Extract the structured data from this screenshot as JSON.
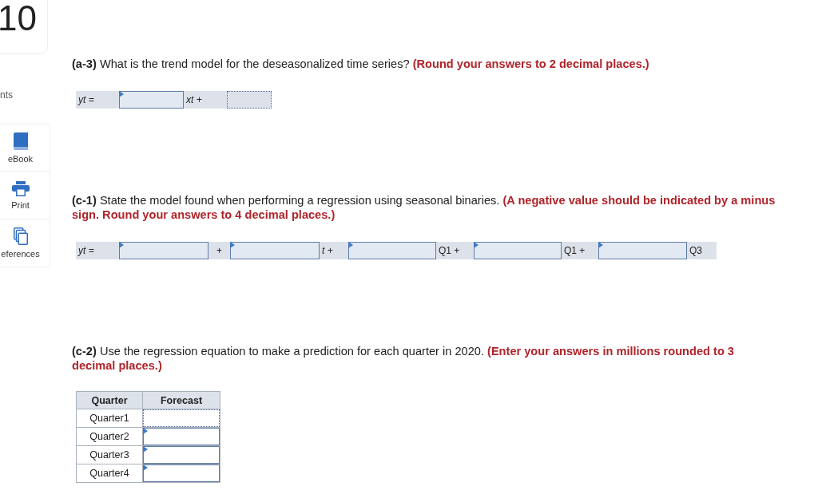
{
  "question_number": "10",
  "sidebar": {
    "points_label": "nts",
    "tools": [
      {
        "kind": "ebook",
        "label": "eBook"
      },
      {
        "kind": "print",
        "label": "Print"
      },
      {
        "kind": "references",
        "label": "eferences"
      }
    ]
  },
  "parts": [
    {
      "label": "(a-3)",
      "text": "What is the trend model for the deseasonalized time series?",
      "instruction": "(Round your answers to 2 decimal places.)",
      "equation": [
        {
          "kind": "variable",
          "text": "yt ="
        },
        {
          "kind": "field",
          "flagged": true,
          "focused": false
        },
        {
          "kind": "variable",
          "text": "xt +"
        },
        {
          "kind": "field",
          "flagged": false,
          "focused": true
        }
      ]
    },
    {
      "label": "(c-1)",
      "text": "State the model found when performing a regression using seasonal binaries.",
      "instruction": "(A negative value should be indicated by a minus sign. Round your answers to 4 decimal places.)",
      "equation": [
        {
          "kind": "variable",
          "text": "yt ="
        },
        {
          "kind": "field",
          "flagged": true,
          "focused": false
        },
        {
          "kind": "operator",
          "text": "+"
        },
        {
          "kind": "field",
          "flagged": true,
          "focused": false
        },
        {
          "kind": "variable",
          "text": "t +"
        },
        {
          "kind": "field",
          "flagged": true,
          "focused": false
        },
        {
          "kind": "label",
          "text": "Q1 +"
        },
        {
          "kind": "field",
          "flagged": true,
          "focused": false
        },
        {
          "kind": "label",
          "text": "Q1 +"
        },
        {
          "kind": "field",
          "flagged": true,
          "focused": false
        },
        {
          "kind": "label",
          "text": "Q3"
        }
      ]
    },
    {
      "label": "(c-2)",
      "text": "Use the regression equation to make a prediction for each quarter in 2020.",
      "instruction": "(Enter your answers in millions rounded to 3 decimal places.)",
      "table": {
        "columns": [
          "Quarter",
          "Forecast"
        ],
        "rows": [
          {
            "quarter": "Quarter1",
            "forecast": {
              "flagged": false,
              "focused": true
            }
          },
          {
            "quarter": "Quarter2",
            "forecast": {
              "flagged": true,
              "focused": false
            }
          },
          {
            "quarter": "Quarter3",
            "forecast": {
              "flagged": true,
              "focused": false
            }
          },
          {
            "quarter": "Quarter4",
            "forecast": {
              "flagged": true,
              "focused": false
            }
          }
        ]
      }
    }
  ]
}
